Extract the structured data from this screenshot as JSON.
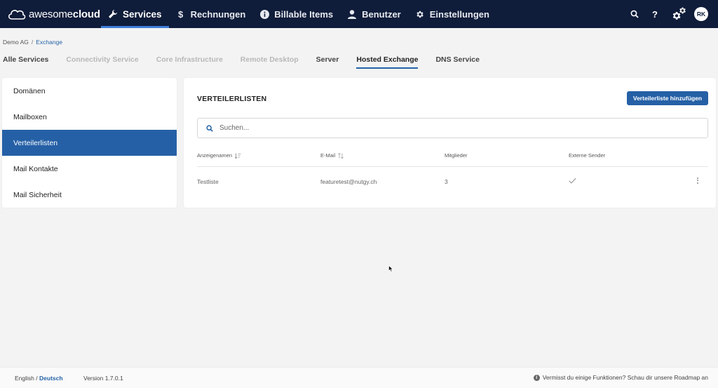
{
  "header": {
    "logo": {
      "brand_light": "awesome",
      "brand_bold": "cloud"
    },
    "nav": [
      {
        "label": "Services",
        "icon": "wrench-icon",
        "active": true
      },
      {
        "label": "Rechnungen",
        "icon": "dollar-icon"
      },
      {
        "label": "Billable Items",
        "icon": "info-icon"
      },
      {
        "label": "Benutzer",
        "icon": "user-icon"
      },
      {
        "label": "Einstellungen",
        "icon": "gear-icon"
      }
    ],
    "right_icons": [
      "search-icon",
      "help-icon",
      "cogs-icon"
    ],
    "avatar_initials": "RK"
  },
  "breadcrumb": {
    "root": "Demo AG",
    "separator": "/",
    "current": "Exchange"
  },
  "tabs": [
    {
      "label": "Alle Services"
    },
    {
      "label": "Connectivity Service"
    },
    {
      "label": "Core Infrastructure"
    },
    {
      "label": "Remote Desktop"
    },
    {
      "label": "Server"
    },
    {
      "label": "Hosted Exchange",
      "active": true
    },
    {
      "label": "DNS Service"
    }
  ],
  "sidebar": {
    "items": [
      {
        "label": "Domänen"
      },
      {
        "label": "Mailboxen"
      },
      {
        "label": "Verteilerlisten",
        "active": true
      },
      {
        "label": "Mail Kontakte"
      },
      {
        "label": "Mail Sicherheit"
      }
    ]
  },
  "main": {
    "title": "VERTEILERLISTEN",
    "add_button": "Verteilerliste hinzufügen",
    "search": {
      "placeholder": "Suchen...",
      "value": ""
    },
    "table": {
      "columns": [
        "Anzeigenamen",
        "E-Mail",
        "Mitglieder",
        "Externe Sender"
      ],
      "rows": [
        {
          "name": "Testliste",
          "email": "featuretest@nutgy.ch",
          "members": "3",
          "external_senders": true
        }
      ]
    }
  },
  "footer": {
    "lang_en": "English",
    "lang_sep": "/",
    "lang_de": "Deutsch",
    "version": "Version 1.7.0.1",
    "roadmap": "Vermisst du einige Funktionen? Schau dir unsere Roadmap an"
  },
  "colors": {
    "nav_bg": "#0f1c3a",
    "accent": "#2560a6",
    "link": "#2563a8"
  }
}
